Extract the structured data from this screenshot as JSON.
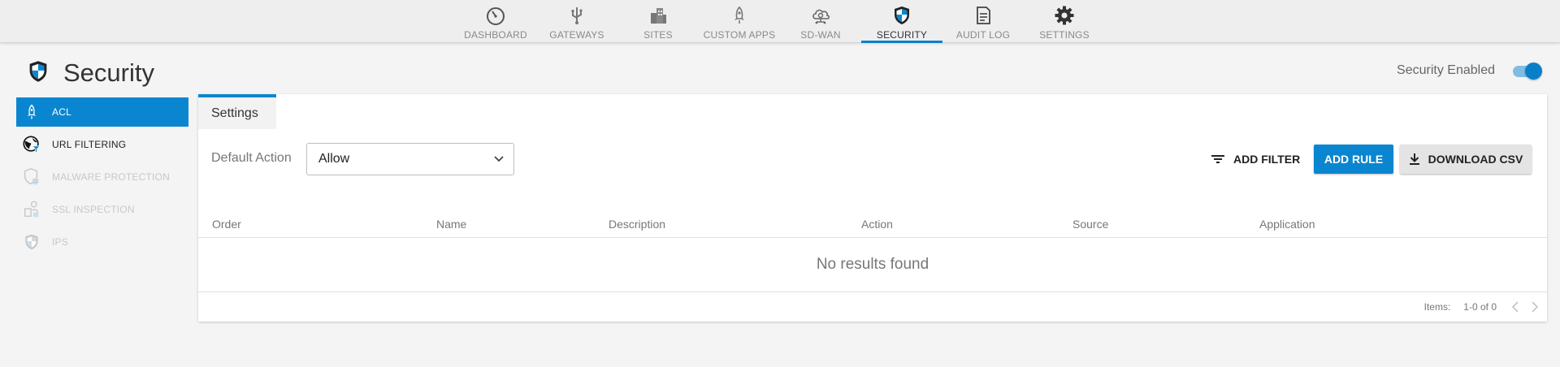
{
  "nav": {
    "items": [
      {
        "label": "DASHBOARD",
        "icon": "gauge-icon"
      },
      {
        "label": "GATEWAYS",
        "icon": "usb-icon"
      },
      {
        "label": "SITES",
        "icon": "buildings-icon"
      },
      {
        "label": "CUSTOM APPS",
        "icon": "rocket-icon"
      },
      {
        "label": "SD-WAN",
        "icon": "cloud-network-icon"
      },
      {
        "label": "SECURITY",
        "icon": "shield-icon"
      },
      {
        "label": "AUDIT LOG",
        "icon": "document-icon"
      },
      {
        "label": "SETTINGS",
        "icon": "gear-icon"
      }
    ],
    "active": "SECURITY",
    "accent": "#0a7fc9"
  },
  "page": {
    "title": "Security",
    "security_enabled_label": "Security Enabled",
    "security_enabled": true
  },
  "sidebar": {
    "items": [
      {
        "label": "ACL",
        "icon": "rocket-icon",
        "state": "active"
      },
      {
        "label": "URL FILTERING",
        "icon": "globe-filter-icon",
        "state": "enabled"
      },
      {
        "label": "MALWARE PROTECTION",
        "icon": "shield-bug-icon",
        "state": "disabled"
      },
      {
        "label": "SSL INSPECTION",
        "icon": "certificate-icon",
        "state": "disabled"
      },
      {
        "label": "IPS",
        "icon": "shield-icon",
        "state": "disabled"
      }
    ]
  },
  "main": {
    "tab_label": "Settings",
    "default_action_label": "Default Action",
    "default_action_value": "Allow",
    "add_filter_label": "ADD FILTER",
    "add_rule_label": "ADD RULE",
    "download_csv_label": "DOWNLOAD CSV",
    "columns": [
      "Order",
      "Name",
      "Description",
      "Action",
      "Source",
      "Application"
    ],
    "empty_text": "No results found",
    "pager": {
      "items_label": "Items:",
      "range": "1-0 of 0"
    }
  },
  "colors": {
    "primary": "#0a86d0",
    "background": "#f4f4f4"
  }
}
